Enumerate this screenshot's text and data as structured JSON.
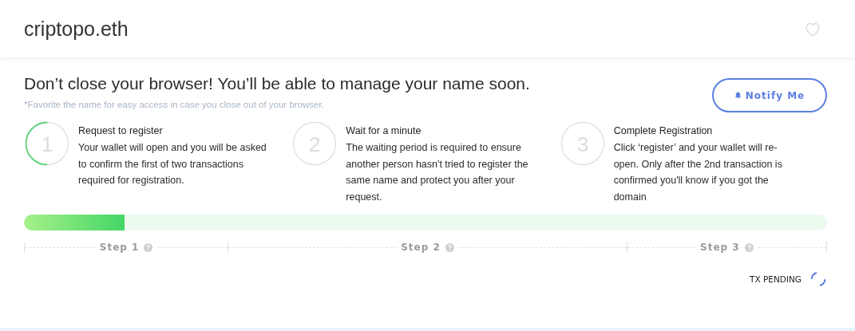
{
  "header": {
    "title": "criptopo.eth",
    "favorite": false
  },
  "notice": {
    "heading": "Don’t close your browser! You’ll be able to manage your name soon.",
    "hint": "*Favorite the name for easy access in case you close out of your browser.",
    "button": "Notify Me"
  },
  "steps": [
    {
      "number": "1",
      "title": "Request to register",
      "text": "Your wallet will open and you will be asked to confirm the first of two transactions required for registration.",
      "active": true
    },
    {
      "number": "2",
      "title": "Wait for a minute",
      "text": "The waiting period is required to ensure another person hasn't tried to register the same name and protect you after your request.",
      "active": false
    },
    {
      "number": "3",
      "title": "Complete Registration",
      "text": "Click ‘register’ and your wallet will re-open. Only after the 2nd transaction is confirmed you'll know if you got the domain",
      "active": false
    }
  ],
  "progress": {
    "level": 0.125
  },
  "step_labels": [
    "Step 1",
    "Step 2",
    "Step 3"
  ],
  "status": "TX PENDING"
}
